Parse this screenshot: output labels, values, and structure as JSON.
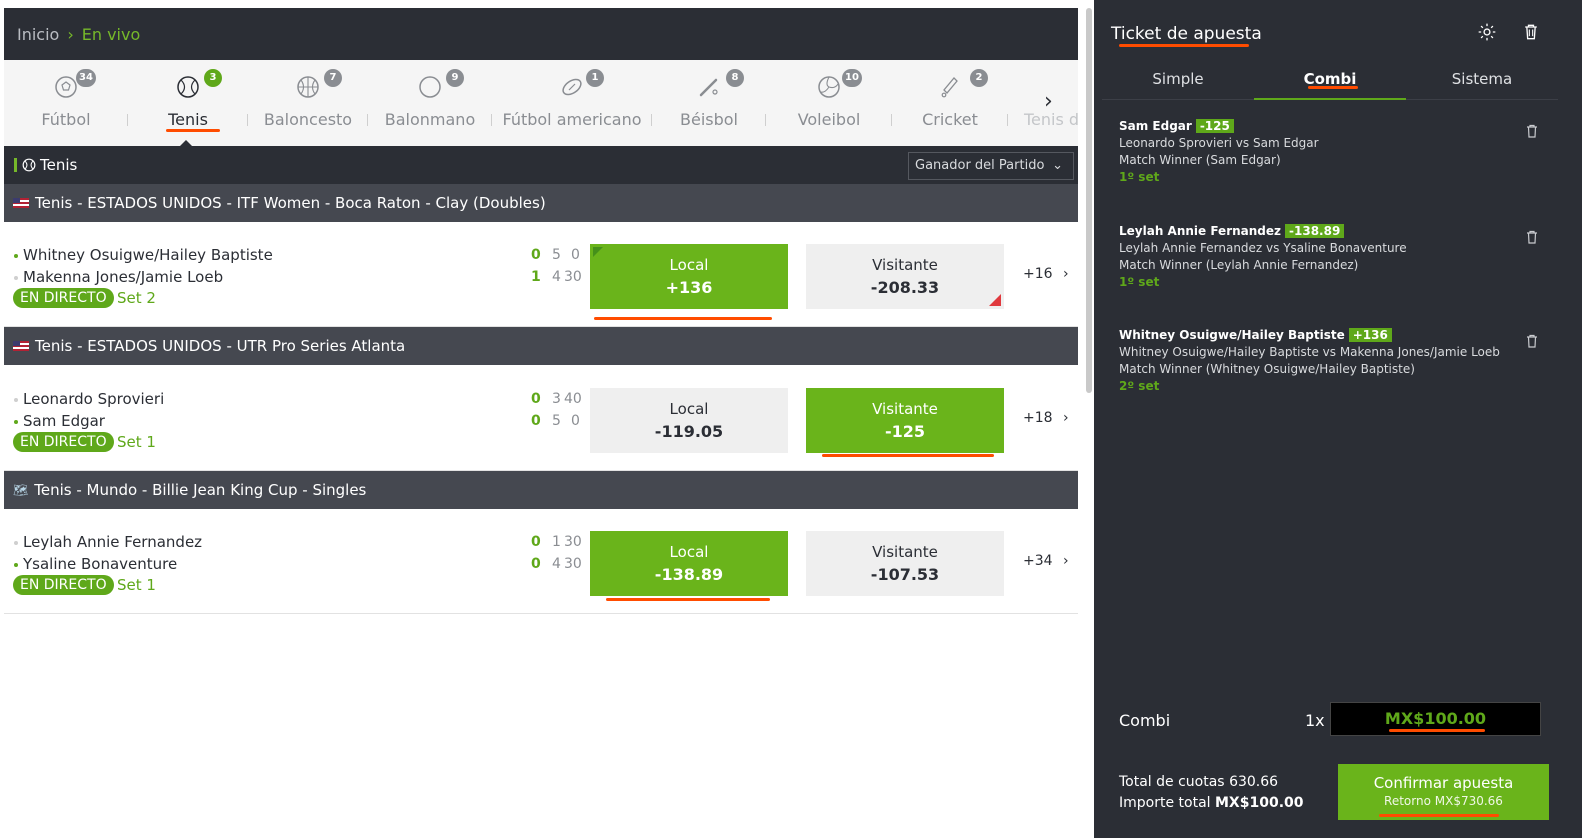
{
  "breadcrumb": {
    "home": "Inicio",
    "current": "En vivo"
  },
  "sports": [
    {
      "label": "Fútbol",
      "count": "34",
      "icon": "soccer-ball-icon"
    },
    {
      "label": "Tenis",
      "count": "3",
      "icon": "tennis-ball-icon",
      "active": true
    },
    {
      "label": "Baloncesto",
      "count": "7",
      "icon": "basketball-icon"
    },
    {
      "label": "Balonmano",
      "count": "9",
      "icon": "handball-icon"
    },
    {
      "label": "Fútbol americano",
      "count": "1",
      "icon": "american-football-icon"
    },
    {
      "label": "Béisbol",
      "count": "8",
      "icon": "baseball-bat-icon"
    },
    {
      "label": "Voleibol",
      "count": "10",
      "icon": "volleyball-icon"
    },
    {
      "label": "Cricket",
      "count": "2",
      "icon": "cricket-bat-icon"
    },
    {
      "label": "Tenis d",
      "count": "",
      "icon": "table-tennis-icon"
    }
  ],
  "section": {
    "title": "Tenis",
    "market": "Ganador del Partido"
  },
  "leagues": [
    {
      "title": "Tenis - ESTADOS UNIDOS - ITF Women - Boca Raton - Clay (Doubles)",
      "flag": "us-flag-icon",
      "match": {
        "home": "Whitney Osuigwe/Hailey Baptiste",
        "away": "Makenna Jones/Jamie Loeb",
        "home_scores": [
          "0",
          "5",
          "0"
        ],
        "away_scores": [
          "1",
          "4",
          "30"
        ],
        "status": "EN DIRECTO",
        "set": "Set 2",
        "local_label": "Local",
        "local_odd": "+136",
        "visitor_label": "Visitante",
        "visitor_odd": "-208.33",
        "more": "+16"
      }
    },
    {
      "title": "Tenis - ESTADOS UNIDOS - UTR Pro Series Atlanta",
      "flag": "us-flag-icon",
      "match": {
        "home": "Leonardo Sprovieri",
        "away": "Sam Edgar",
        "home_scores": [
          "0",
          "3",
          "40"
        ],
        "away_scores": [
          "0",
          "5",
          "0"
        ],
        "status": "EN DIRECTO",
        "set": "Set 1",
        "local_label": "Local",
        "local_odd": "-119.05",
        "visitor_label": "Visitante",
        "visitor_odd": "-125",
        "more": "+18"
      }
    },
    {
      "title": "Tenis - Mundo - Billie Jean King Cup - Singles",
      "flag": "world-map-icon",
      "match": {
        "home": "Leylah Annie Fernandez",
        "away": "Ysaline Bonaventure",
        "home_scores": [
          "0",
          "1",
          "30"
        ],
        "away_scores": [
          "0",
          "4",
          "30"
        ],
        "status": "EN DIRECTO",
        "set": "Set 1",
        "local_label": "Local",
        "local_odd": "-138.89",
        "visitor_label": "Visitante",
        "visitor_odd": "-107.53",
        "more": "+34"
      }
    }
  ],
  "ticket": {
    "title": "Ticket de apuesta",
    "tabs": [
      "Simple",
      "Combi",
      "Sistema"
    ],
    "bets": [
      {
        "name": "Sam Edgar",
        "odds": "-125",
        "event": "Leonardo Sprovieri vs Sam Edgar",
        "market": "Match Winner (Sam Edgar)",
        "period": "1º set"
      },
      {
        "name": "Leylah Annie Fernandez",
        "odds": "-138.89",
        "event": "Leylah Annie Fernandez vs Ysaline Bonaventure",
        "market": "Match Winner (Leylah Annie Fernandez)",
        "period": "1º set"
      },
      {
        "name": "Whitney Osuigwe/Hailey Baptiste",
        "odds": "+136",
        "event": "Whitney Osuigwe/Hailey Baptiste vs Makenna Jones/Jamie Loeb",
        "market": "Match Winner (Whitney Osuigwe/Hailey Baptiste)",
        "period": "2º set"
      }
    ],
    "combi_label": "Combi",
    "multiplier": "1x",
    "stake": "MX$100.00",
    "total_odds_label": "Total de cuotas",
    "total_odds": "630.66",
    "total_amount_label": "Importe total",
    "total_amount": "MX$100.00",
    "confirm_label": "Confirmar apuesta",
    "return_label": "Retorno MX$730.66"
  },
  "colors": {
    "accent": "#6ab41b",
    "dark": "#2b2e35",
    "highlight": "#ff4c00"
  }
}
